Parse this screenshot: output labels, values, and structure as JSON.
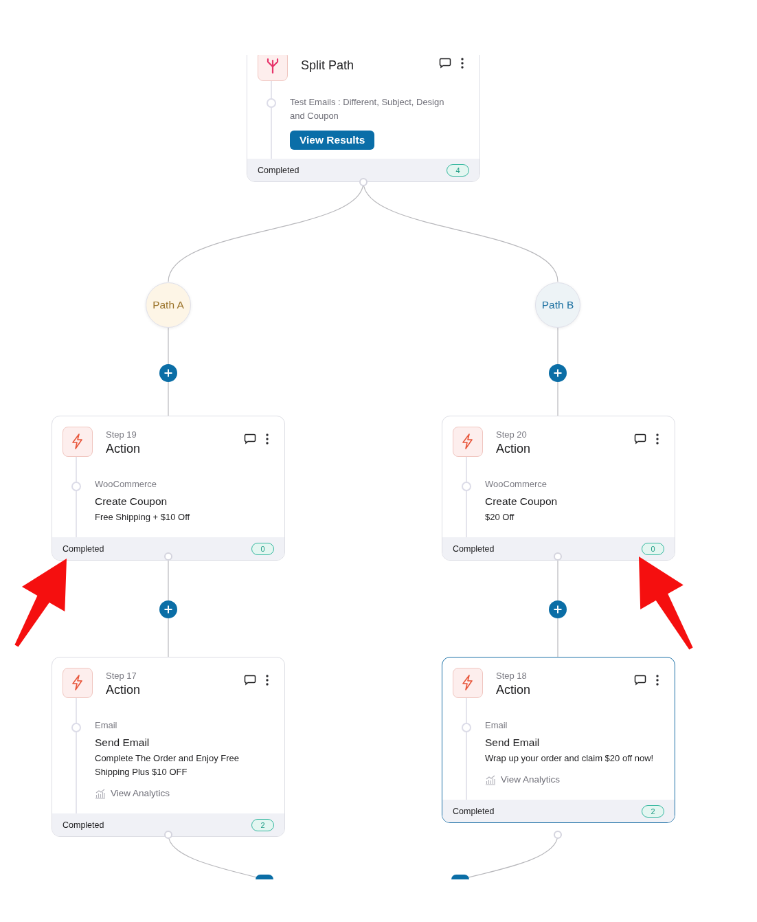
{
  "split_step": {
    "title": "Split Path",
    "description": "Test Emails : Different, Subject, Design and Coupon",
    "button": "View Results",
    "status": "Completed",
    "count": "4",
    "selected": false
  },
  "paths": [
    {
      "label": "Path A",
      "kind": "a"
    },
    {
      "label": "Path B",
      "kind": "b"
    }
  ],
  "steps": [
    {
      "step": "Step 19",
      "title": "Action",
      "category": "WooCommerce",
      "name": "Create Coupon",
      "detail": "Free Shipping + $10 Off",
      "status": "Completed",
      "count": "0",
      "selected": false
    },
    {
      "step": "Step 20",
      "title": "Action",
      "category": "WooCommerce",
      "name": "Create Coupon",
      "detail": "$20 Off",
      "status": "Completed",
      "count": "0",
      "selected": false
    },
    {
      "step": "Step 17",
      "title": "Action",
      "category": "Email",
      "name": "Send Email",
      "detail": "Complete The Order and Enjoy Free Shipping Plus $10 OFF",
      "analytics": "View Analytics",
      "status": "Completed",
      "count": "2",
      "selected": false
    },
    {
      "step": "Step 18",
      "title": "Action",
      "category": "Email",
      "name": "Send Email",
      "detail": "Wrap up your order and claim $20 off now!",
      "analytics": "View Analytics",
      "status": "Completed",
      "count": "2",
      "selected": true
    }
  ],
  "annotation_arrows": [
    {
      "kind": "up-right"
    },
    {
      "kind": "up-left"
    }
  ]
}
